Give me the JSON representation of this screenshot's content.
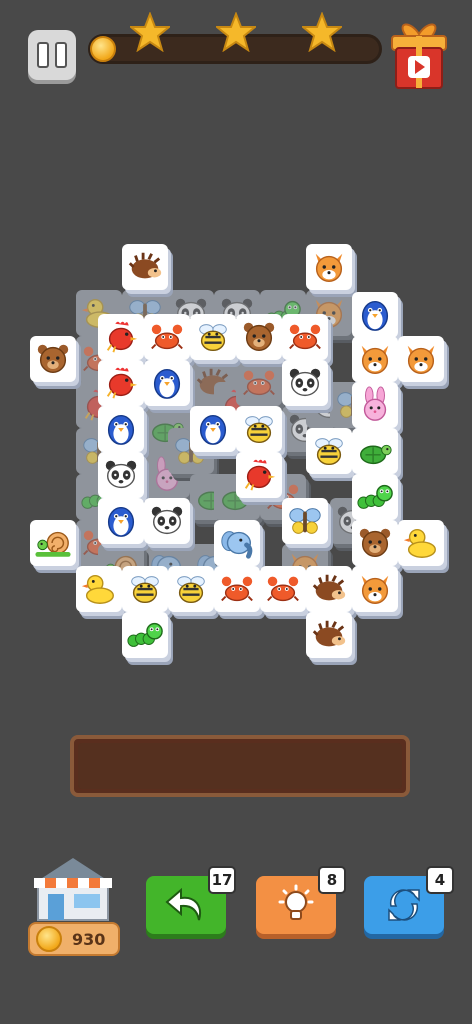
{
  "hud": {
    "stars_earned": 0,
    "stars_total": 3,
    "level_progress": 0.0
  },
  "board": {
    "tiles_top": [
      {
        "animal": "hedgehog"
      },
      {
        "animal": "fox"
      },
      {
        "animal": "bear"
      },
      {
        "animal": "rooster"
      },
      {
        "animal": "crab"
      },
      {
        "animal": "bee"
      },
      {
        "animal": "bear"
      },
      {
        "animal": "crab"
      },
      {
        "animal": "penguin"
      },
      {
        "animal": "fox"
      },
      {
        "animal": "fox"
      },
      {
        "animal": "rooster"
      },
      {
        "animal": "penguin"
      },
      {
        "animal": "panda"
      },
      {
        "animal": "rabbit"
      },
      {
        "animal": "penguin"
      },
      {
        "animal": "penguin"
      },
      {
        "animal": "bee"
      },
      {
        "animal": "bee"
      },
      {
        "animal": "turtle"
      },
      {
        "animal": "panda"
      },
      {
        "animal": "rooster"
      },
      {
        "animal": "caterpillar"
      },
      {
        "animal": "penguin"
      },
      {
        "animal": "panda"
      },
      {
        "animal": "elephant"
      },
      {
        "animal": "butterfly"
      },
      {
        "animal": "snail"
      },
      {
        "animal": "bear"
      },
      {
        "animal": "duck"
      },
      {
        "animal": "duck"
      },
      {
        "animal": "bee"
      },
      {
        "animal": "bee"
      },
      {
        "animal": "crab"
      },
      {
        "animal": "crab"
      },
      {
        "animal": "hedgehog"
      },
      {
        "animal": "fox"
      },
      {
        "animal": "caterpillar"
      },
      {
        "animal": "hedgehog"
      }
    ]
  },
  "slot_bar": {
    "capacity": 7,
    "filled": 0
  },
  "shop": {
    "coins": "930"
  },
  "powerups": {
    "undo_count": "17",
    "hint_count": "8",
    "shuffle_count": "4"
  },
  "colors": {
    "background": "#494949",
    "undo": "#43b52a",
    "hint": "#f39044",
    "shuffle": "#3c9ee8"
  }
}
